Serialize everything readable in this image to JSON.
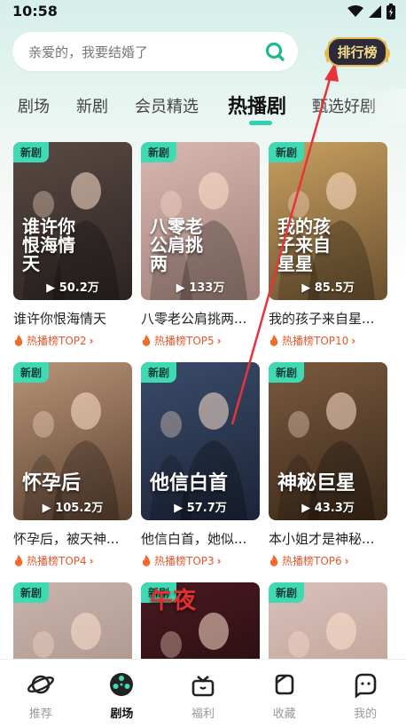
{
  "status_bar": {
    "time": "10:58"
  },
  "search": {
    "placeholder": "亲爱的，我要结婚了"
  },
  "rank_button": {
    "label": "排行榜"
  },
  "tabs": [
    {
      "label": "剧场"
    },
    {
      "label": "新剧"
    },
    {
      "label": "会员精选"
    },
    {
      "label": "热播剧"
    },
    {
      "label": "甄选好剧"
    }
  ],
  "cards": [
    {
      "badge": "新剧",
      "poster_text": "谁许你恨海情天",
      "views": "50.2万",
      "title": "谁许你恨海情天",
      "rank": "热播榜TOP2",
      "color1": "#5a4a44",
      "color2": "#2c2422"
    },
    {
      "badge": "新剧",
      "poster_text": "八零老公肩挑两",
      "views": "133万",
      "title": "八零老公肩挑两...",
      "rank": "热播榜TOP5",
      "color1": "#d8b8b0",
      "color2": "#a08078"
    },
    {
      "badge": "新剧",
      "poster_text": "我的孩子来自星星",
      "views": "85.5万",
      "title": "我的孩子来自星...",
      "rank": "热播榜TOP10",
      "color1": "#c8a060",
      "color2": "#6a5030"
    },
    {
      "badge": "新剧",
      "poster_text": "怀孕后",
      "views": "105.2万",
      "title": "怀孕后，被天神...",
      "rank": "热播榜TOP4",
      "color1": "#b89478",
      "color2": "#5a4030"
    },
    {
      "badge": "新剧",
      "poster_text": "他信白首",
      "views": "57.7万",
      "title": "他信白首，她似...",
      "rank": "热播榜TOP3",
      "color1": "#3a4c6a",
      "color2": "#1c2438"
    },
    {
      "badge": "新剧",
      "poster_text": "神秘巨星",
      "views": "43.3万",
      "title": "本小姐才是神秘...",
      "rank": "热播榜TOP6",
      "color1": "#7a5a40",
      "color2": "#3a2818"
    },
    {
      "badge": "新剧",
      "poster_text": "",
      "views": "",
      "title": "",
      "rank": "",
      "color1": "#c9b4ac",
      "color2": "#a08880"
    },
    {
      "badge": "新剧",
      "poster_text": "午夜",
      "views": "",
      "title": "",
      "rank": "",
      "color1": "#4a1a20",
      "color2": "#1a0a0e"
    },
    {
      "badge": "新剧",
      "poster_text": "",
      "views": "",
      "title": "",
      "rank": "",
      "color1": "#d8c0b8",
      "color2": "#b89890"
    }
  ],
  "bottom_nav": [
    {
      "label": "推荐",
      "icon": "planet-icon"
    },
    {
      "label": "剧场",
      "icon": "film-reel-icon"
    },
    {
      "label": "福利",
      "icon": "gift-icon"
    },
    {
      "label": "收藏",
      "icon": "bookmark-icon"
    },
    {
      "label": "我的",
      "icon": "profile-icon"
    }
  ]
}
